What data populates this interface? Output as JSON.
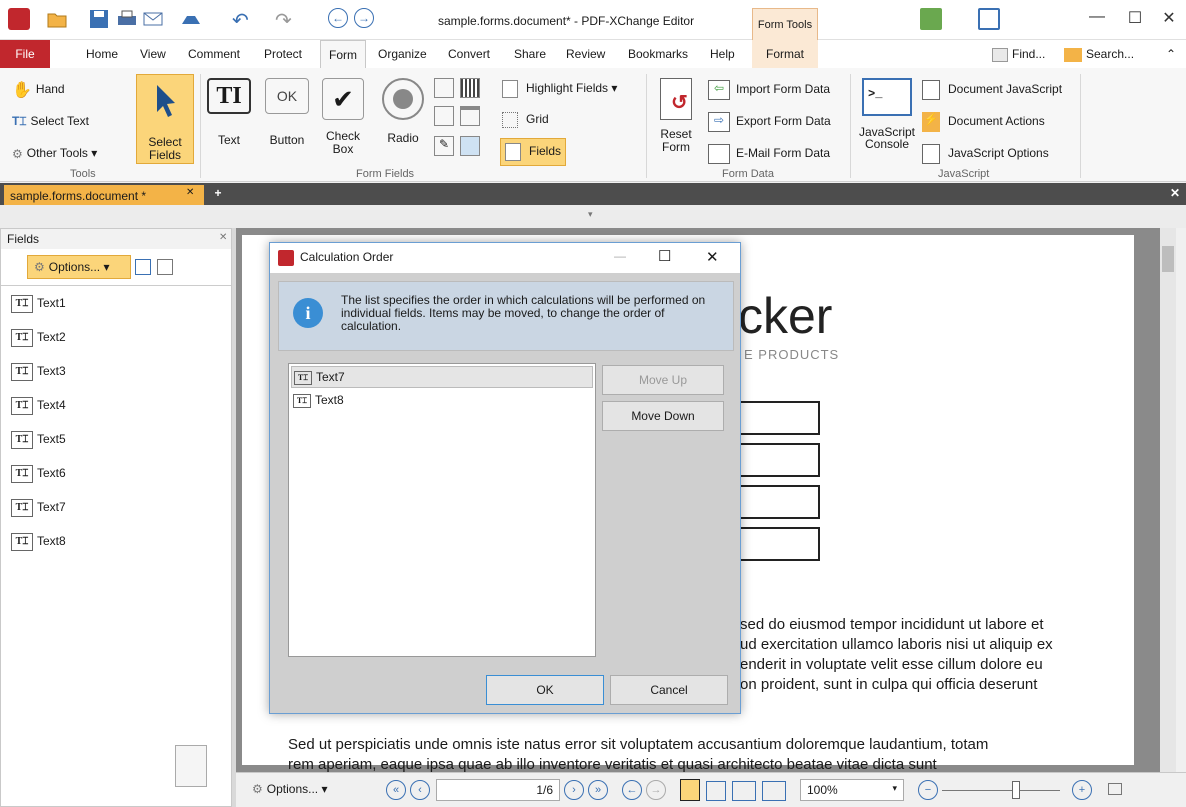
{
  "window": {
    "title": "sample.forms.document* - PDF-XChange Editor",
    "context_tab": "Form Tools"
  },
  "menu": {
    "tabs": [
      "File",
      "Home",
      "View",
      "Comment",
      "Protect",
      "Form",
      "Organize",
      "Convert",
      "Share",
      "Review",
      "Bookmarks",
      "Help",
      "Format"
    ],
    "find_label": "Find...",
    "search_label": "Search..."
  },
  "ribbon": {
    "tools": {
      "hand": "Hand",
      "select_text": "Select Text",
      "other_tools": "Other Tools",
      "select_fields": "Select Fields",
      "group": "Tools"
    },
    "form_fields": {
      "text": "Text",
      "button": "Button",
      "check_box": "Check Box",
      "radio": "Radio",
      "highlight_fields": "Highlight Fields",
      "grid": "Grid",
      "fields": "Fields",
      "group": "Form Fields",
      "ok_icon": "OK"
    },
    "form_data": {
      "reset_form": "Reset Form",
      "import": "Import Form Data",
      "export": "Export Form Data",
      "email": "E-Mail Form Data",
      "group": "Form Data"
    },
    "javascript": {
      "console": "JavaScript Console",
      "doc_js": "Document JavaScript",
      "doc_actions": "Document Actions",
      "js_options": "JavaScript Options",
      "group": "JavaScript"
    }
  },
  "doc_tab": {
    "label": "sample.forms.document *"
  },
  "fields_panel": {
    "title": "Fields",
    "options_label": "Options...",
    "items": [
      "Text1",
      "Text2",
      "Text3",
      "Text4",
      "Text5",
      "Text6",
      "Text7",
      "Text8"
    ]
  },
  "page": {
    "heading_fragment": "cker",
    "subheading_fragment": "E PRODUCTS",
    "para_lines": [
      "sed do eiusmod tempor incididunt ut labore et",
      "ud exercitation ullamco laboris nisi ut aliquip ex",
      "enderit in voluptate velit esse cillum dolore eu",
      "on proident, sunt in culpa qui officia deserunt"
    ],
    "bottom_line1": "Sed ut perspiciatis unde omnis iste natus error sit voluptatem accusantium doloremque laudantium, totam",
    "bottom_line2": "rem aperiam, eaque ipsa quae ab illo inventore veritatis et quasi architecto beatae vitae dicta sunt"
  },
  "dialog": {
    "title": "Calculation Order",
    "info": "The list specifies the order in which calculations will be performed on individual fields. Items may be moved, to change the order of calculation.",
    "list_items": [
      "Text7",
      "Text8"
    ],
    "move_up": "Move Up",
    "move_down": "Move Down",
    "ok": "OK",
    "cancel": "Cancel"
  },
  "statusbar": {
    "options_label": "Options...",
    "page_indicator": "1/6",
    "zoom": "100%"
  },
  "colors": {
    "accent": "#c1272d",
    "doc_tab": "#f3b347",
    "context": "#fbe9d5",
    "info_bg": "#cad6e3"
  }
}
